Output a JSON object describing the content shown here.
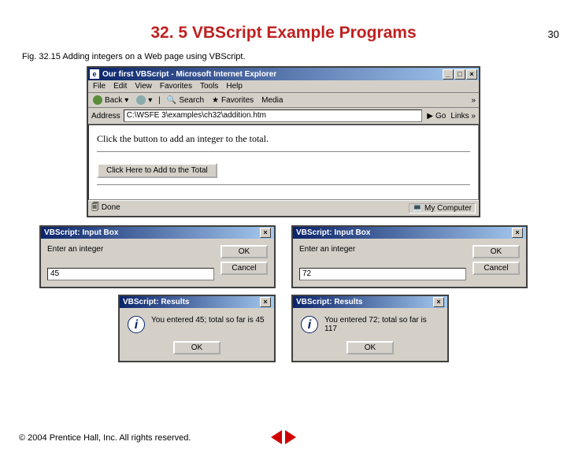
{
  "page_number": "30",
  "heading": "32. 5 VBScript Example Programs",
  "figure_caption": "Fig. 32.15    Adding integers on a Web page using VBScript.",
  "ie": {
    "title_icon": "e",
    "title": "Our first VBScript - Microsoft Internet Explorer",
    "menus": [
      "File",
      "Edit",
      "View",
      "Favorites",
      "Tools",
      "Help"
    ],
    "back": "Back",
    "search": "Search",
    "favorites": "Favorites",
    "media": "Media",
    "more": "»",
    "addr_label": "Address",
    "addr_value": "C:\\WSFE 3\\examples\\ch32\\addition.htm",
    "go": "Go",
    "links": "Links »",
    "body_text": "Click the button to add an integer to the total.",
    "button_label": "Click Here to Add to the Total",
    "status_done": "Done",
    "status_zone": "My Computer"
  },
  "input_dialogs": {
    "title": "VBScript: Input Box",
    "prompt": "Enter an integer",
    "ok": "OK",
    "cancel": "Cancel",
    "left_value": "45",
    "right_value": "72"
  },
  "result_dialogs": {
    "title": "VBScript: Results",
    "left_text": "You entered 45; total so far is 45",
    "right_text": "You entered 72; total so far is 117",
    "ok": "OK"
  },
  "footer": "© 2004 Prentice Hall, Inc.  All rights reserved."
}
